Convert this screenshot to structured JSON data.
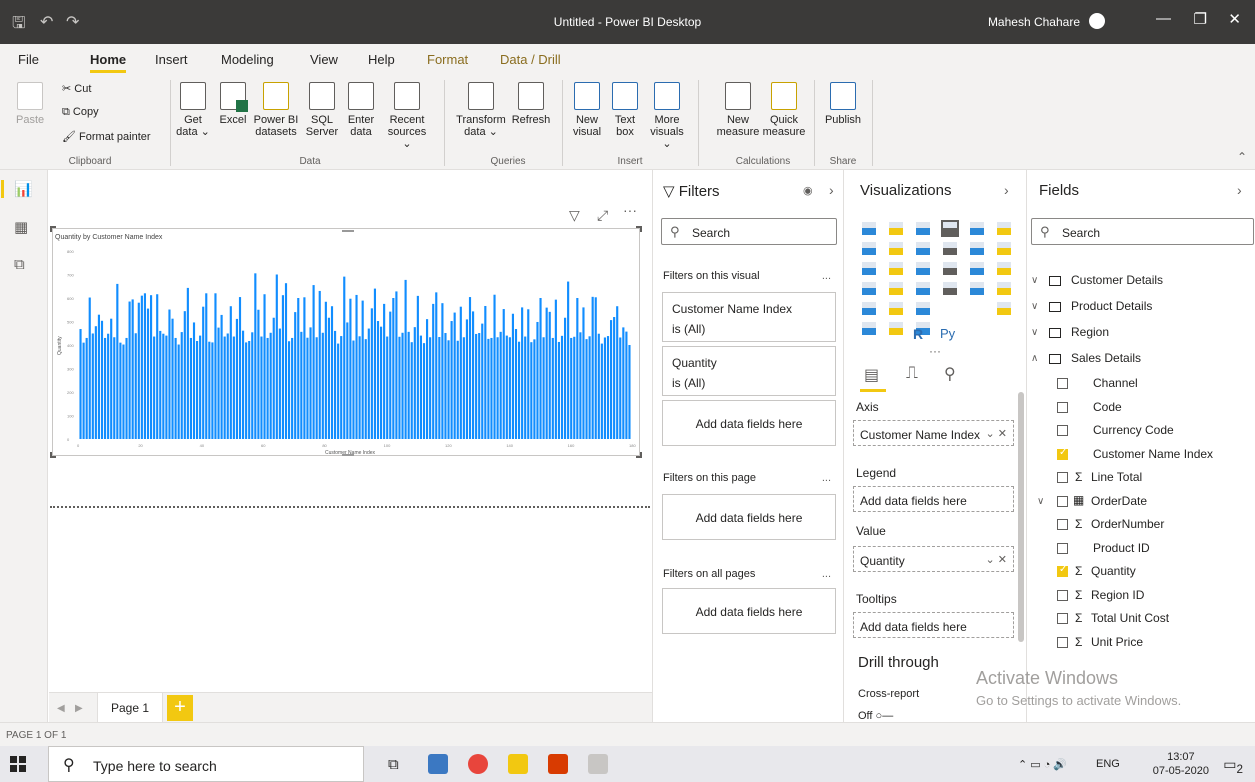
{
  "titlebar": {
    "title": "Untitled - Power BI Desktop",
    "user": "Mahesh Chahare"
  },
  "menu": [
    "File",
    "Home",
    "Insert",
    "Modeling",
    "View",
    "Help",
    "Format",
    "Data / Drill"
  ],
  "ribbon": {
    "clipboard": {
      "paste": "Paste",
      "cut": "Cut",
      "copy": "Copy",
      "format_painter": "Format painter",
      "label": "Clipboard"
    },
    "data": {
      "get_data": [
        "Get",
        "data ⌄"
      ],
      "excel": [
        "Excel",
        ""
      ],
      "pbi_datasets": [
        "Power BI",
        "datasets"
      ],
      "sql_server": [
        "SQL",
        "Server"
      ],
      "enter_data": [
        "Enter",
        "data"
      ],
      "recent_sources": [
        "Recent",
        "sources ⌄"
      ],
      "label": "Data"
    },
    "queries": {
      "transform": [
        "Transform",
        "data ⌄"
      ],
      "refresh": [
        "Refresh",
        ""
      ],
      "label": "Queries"
    },
    "insert": {
      "new_visual": [
        "New",
        "visual"
      ],
      "text_box": [
        "Text",
        "box"
      ],
      "more_visuals": [
        "More",
        "visuals ⌄"
      ],
      "label": "Insert"
    },
    "calculations": {
      "new_measure": [
        "New",
        "measure"
      ],
      "quick_measure": [
        "Quick",
        "measure"
      ],
      "label": "Calculations"
    },
    "share": {
      "publish": "Publish",
      "label": "Share"
    }
  },
  "canvas": {
    "visual_title": "Quantity by Customer Name Index",
    "page_tab": "Page 1",
    "status": "PAGE 1 OF 1"
  },
  "chart_data": {
    "type": "bar",
    "title": "Quantity by Customer Name Index",
    "xlabel": "Customer Name Index",
    "ylabel": "Quantity",
    "x": [
      1,
      180
    ],
    "xlim": [
      0,
      180
    ],
    "ylim": [
      0,
      800
    ],
    "x_ticks": [
      "0",
      "20",
      "40",
      "60",
      "80",
      "100",
      "120",
      "140",
      "160",
      "180"
    ],
    "y_ticks": [
      "0",
      "100",
      "200",
      "300",
      "400",
      "500",
      "600",
      "700",
      "800"
    ],
    "values": [
      468,
      410,
      430,
      602,
      449,
      480,
      529,
      503,
      430,
      448,
      512,
      433,
      660,
      410,
      402,
      430,
      585,
      594,
      450,
      580,
      610,
      620,
      555,
      612,
      436,
      616,
      460,
      448,
      440,
      551,
      512,
      430,
      402,
      455,
      544,
      643,
      430,
      496,
      417,
      440,
      563,
      620,
      414,
      411,
      620,
      474,
      528,
      436,
      449,
      565,
      436,
      511,
      604,
      461,
      411,
      417,
      454,
      705,
      550,
      436,
      616,
      430,
      452,
      516,
      700,
      470,
      612,
      663,
      416,
      430,
      540,
      600,
      456,
      603,
      431,
      475,
      655,
      433,
      630,
      452,
      584,
      516,
      565,
      460,
      406,
      438,
      691,
      496,
      597,
      419,
      613,
      437,
      589,
      425,
      470,
      556,
      640,
      502,
      478,
      575,
      436,
      542,
      600,
      628,
      435,
      452,
      677,
      456,
      412,
      476,
      609,
      440,
      408,
      510,
      433,
      575,
      624,
      434,
      578,
      451,
      420,
      502,
      538,
      418,
      563,
      433,
      509,
      604,
      543,
      447,
      451,
      491,
      566,
      426,
      430,
      614,
      433,
      456,
      553,
      440,
      433,
      533,
      468,
      414,
      560,
      436,
      552,
      412,
      424,
      498,
      600,
      433,
      559,
      541,
      430,
      593,
      413,
      439,
      516,
      670,
      430,
      435,
      600,
      454,
      560,
      425,
      437,
      605,
      603,
      448,
      406,
      432,
      438,
      506,
      519,
      565,
      432,
      475,
      457,
      400
    ],
    "color": "#118dff"
  },
  "filters": {
    "title": "Filters",
    "search": "Search",
    "on_visual": "Filters on this visual",
    "cards": [
      {
        "name": "Customer Name Index",
        "state": "is (All)"
      },
      {
        "name": "Quantity",
        "state": "is (All)"
      }
    ],
    "add": "Add data fields here",
    "on_page": "Filters on this page",
    "on_all": "Filters on all pages",
    "more": "..."
  },
  "visualizations": {
    "title": "Visualizations",
    "axis": "Axis",
    "axis_value": "Customer Name Index",
    "legend": "Legend",
    "legend_value": "Add data fields here",
    "value": "Value",
    "value_value": "Quantity",
    "tooltips": "Tooltips",
    "tooltips_value": "Add data fields here",
    "drill": "Drill through",
    "cross_report": "Cross-report",
    "off": "Off",
    "r_label": "R",
    "py_label": "Py",
    "more": "···"
  },
  "fields": {
    "title": "Fields",
    "search": "Search",
    "tables": [
      "Customer Details",
      "Product Details",
      "Region",
      "Sales Details"
    ],
    "sales_fields": [
      {
        "name": "Channel",
        "sigma": false,
        "checked": false
      },
      {
        "name": "Code",
        "sigma": false,
        "checked": false
      },
      {
        "name": "Currency Code",
        "sigma": false,
        "checked": false
      },
      {
        "name": "Customer Name Index",
        "sigma": false,
        "checked": true
      },
      {
        "name": "Line Total",
        "sigma": true,
        "checked": false
      },
      {
        "name": "OrderDate",
        "sigma": false,
        "checked": false
      },
      {
        "name": "OrderNumber",
        "sigma": true,
        "checked": false
      },
      {
        "name": "Product ID",
        "sigma": false,
        "checked": false
      },
      {
        "name": "Quantity",
        "sigma": true,
        "checked": true
      },
      {
        "name": "Region ID",
        "sigma": true,
        "checked": false
      },
      {
        "name": "Total Unit Cost",
        "sigma": true,
        "checked": false
      },
      {
        "name": "Unit Price",
        "sigma": true,
        "checked": false
      }
    ]
  },
  "watermark": {
    "line1": "Activate Windows",
    "line2": "Go to Settings to activate Windows."
  },
  "taskbar": {
    "search": "Type here to search",
    "lang": "ENG",
    "time": "13:07",
    "date": "07-05-2020",
    "badge": "2"
  }
}
